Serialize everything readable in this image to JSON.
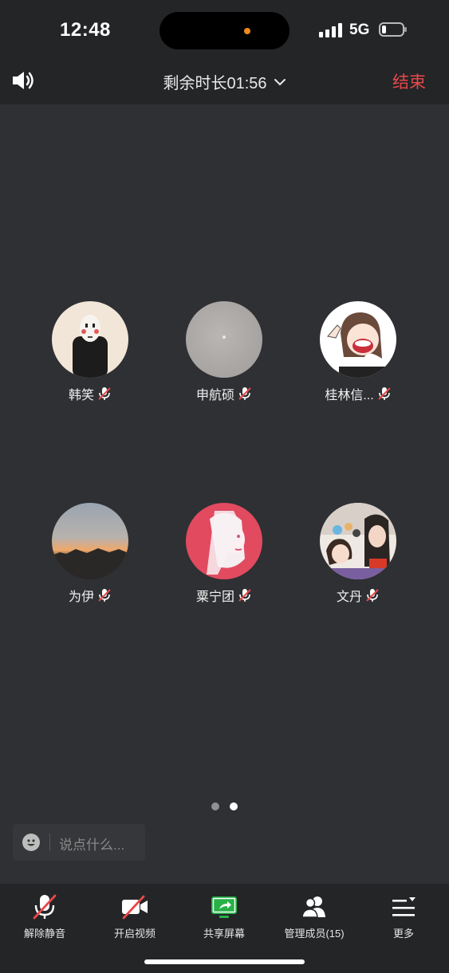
{
  "status_bar": {
    "time": "12:48",
    "network": "5G",
    "battery_level": 0.2
  },
  "header": {
    "timer_label": "剩余时长01:56",
    "end_label": "结束"
  },
  "participants": [
    {
      "name": "韩笑"
    },
    {
      "name": "申航硕"
    },
    {
      "name": "桂林信..."
    },
    {
      "name": "为伊"
    },
    {
      "name": "粟宁团"
    },
    {
      "name": "文丹"
    }
  ],
  "pager": {
    "pages": 2,
    "current_page": 2
  },
  "chat": {
    "placeholder": "说点什么..."
  },
  "toolbar": {
    "unmute_label": "解除静音",
    "video_label": "开启视频",
    "share_label": "共享屏幕",
    "members_label": "管理成员(15)",
    "more_label": "更多"
  },
  "colors": {
    "accent_end": "#e8484a",
    "share_green": "#27b148",
    "mute_red": "#e8484a"
  }
}
